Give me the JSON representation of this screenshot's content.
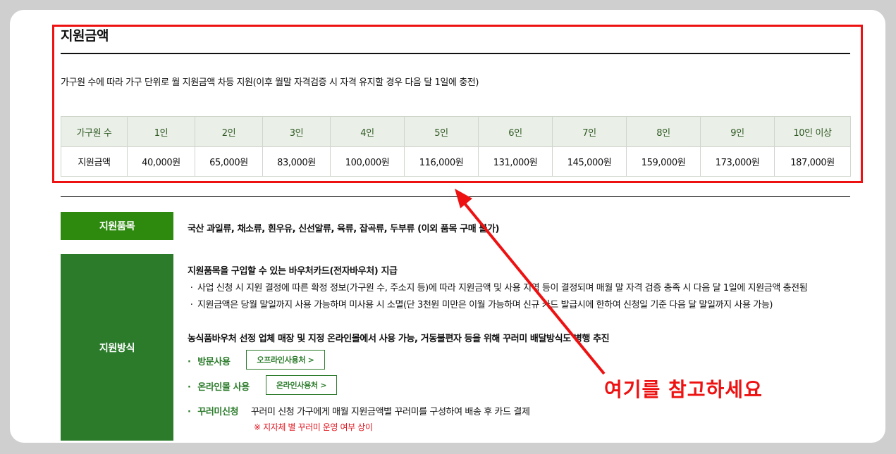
{
  "section": {
    "title": "지원금액",
    "description": "가구원 수에 따라 가구 단위로 월 지원금액 차등 지원(이후 월말 자격검증 시 자격 유지할 경우 다음 달 1일에 충전)"
  },
  "amount_table": {
    "header_label": "가구원 수",
    "row_label": "지원금액",
    "columns": [
      "1인",
      "2인",
      "3인",
      "4인",
      "5인",
      "6인",
      "7인",
      "8인",
      "9인",
      "10인 이상"
    ],
    "amounts": [
      "40,000원",
      "65,000원",
      "83,000원",
      "100,000원",
      "116,000원",
      "131,000원",
      "145,000원",
      "159,000원",
      "173,000원",
      "187,000원"
    ]
  },
  "items": {
    "label": "지원품목",
    "text": "국산 과일류, 채소류, 흰우유, 신선알류, 육류, 잡곡류, 두부류 (이외 품목 구매 불가)"
  },
  "method": {
    "label": "지원방식",
    "card_heading": "지원품목을 구입할 수 있는 바우처카드(전자바우처) 지급",
    "card_bullets": [
      "사업 신청 시 지원 결정에 따른 확정 정보(가구원 수, 주소지 등)에 따라 지원금액 및 사용 지역 등이 결정되며 매월 말 자격 검증 충족 시 다음 달 1일에 지원금액 충전됨",
      "지원금액은 당월 말일까지 사용 가능하며 미사용 시 소멸(단 3천원 미만은 이월 가능하며 신규 카드 발급시에 한하여 신청일 기준 다음 달 말일까지 사용 가능)"
    ],
    "usage_heading": "농식품바우처 선정 업체 매장 및 지정 온라인몰에서 사용 가능, 거동불편자 등을 위해 꾸러미 배달방식도 병행 추진",
    "usage_bullet_glyph": "·",
    "visit_label": "방문사용",
    "visit_button": "오프라인사용처 >",
    "online_label": "온라인몰 사용",
    "online_button": "온라인사용처 >",
    "package_label": "꾸러미신청",
    "package_text": "꾸러미 신청 가구에게 매월 지원금액별 꾸러미를 구성하여 배송 후 카드 결제",
    "package_note": "※ 지자체 별 꾸러미 운영 여부 상이"
  },
  "annotation": {
    "callout_text": "여기를 참고하세요",
    "color": "#ee1111"
  },
  "colors": {
    "accent_green": "#2d8a0f",
    "method_green": "#2b7b2b",
    "table_header_bg": "#eaefe7",
    "highlight_red": "#ee1111"
  }
}
